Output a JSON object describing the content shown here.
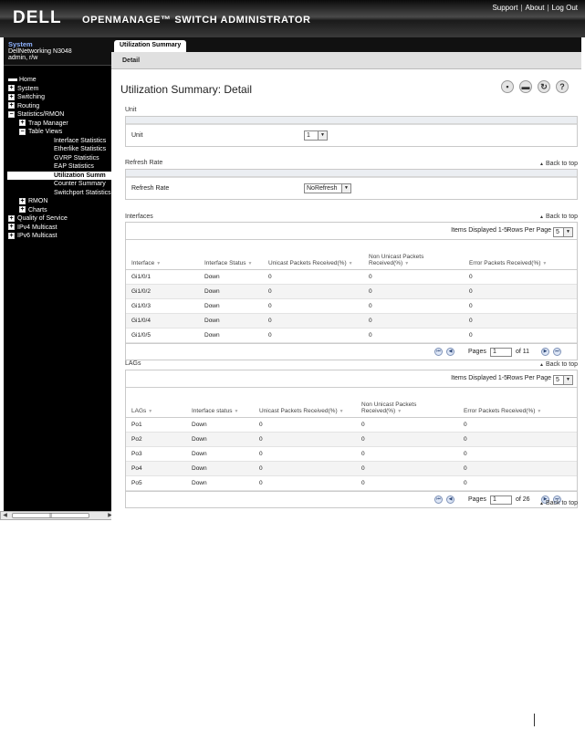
{
  "header": {
    "logo": "DELL",
    "product": "OPENMANAGE™ SWITCH ADMINISTRATOR",
    "links": [
      "Support",
      "About",
      "Log Out"
    ]
  },
  "sidebar": {
    "system_title": "System",
    "system_model": "DellNetworking N3048",
    "user": "admin, r/w",
    "items": [
      {
        "label": "Home"
      },
      {
        "label": "System"
      },
      {
        "label": "Switching"
      },
      {
        "label": "Routing"
      },
      {
        "label": "Statistics/RMON"
      },
      {
        "label": "Trap Manager"
      },
      {
        "label": "Table Views"
      },
      {
        "label": "Interface Statistics"
      },
      {
        "label": "Etherlike Statistics"
      },
      {
        "label": "GVRP Statistics"
      },
      {
        "label": "EAP Statistics"
      },
      {
        "label": "Utilization Summ"
      },
      {
        "label": "Counter Summary"
      },
      {
        "label": "Switchport Statistics"
      },
      {
        "label": "RMON"
      },
      {
        "label": "Charts"
      },
      {
        "label": "Quality of Service"
      },
      {
        "label": "IPv4 Multicast"
      },
      {
        "label": "IPv6 Multicast"
      }
    ]
  },
  "tabs": {
    "active": "Utilization Summary",
    "sub": "Detail"
  },
  "page": {
    "title": "Utilization Summary: Detail",
    "back_to_top": "Back to top"
  },
  "unit": {
    "section": "Unit",
    "label": "Unit",
    "value": "1"
  },
  "refresh": {
    "section": "Refresh Rate",
    "label": "Refresh Rate",
    "value": "NoRefresh"
  },
  "interfaces": {
    "section": "Interfaces",
    "items_displayed": "Items Displayed 1-5",
    "rows_per_page_label": "Rows Per Page",
    "rows_per_page": "5",
    "columns": [
      "Interface",
      "Interface Status",
      "Unicast Packets Received(%)",
      "Non Unicast Packets Received(%)",
      "Error Packets Received(%)"
    ],
    "rows": [
      [
        "Gi1/0/1",
        "Down",
        "0",
        "0",
        "0"
      ],
      [
        "Gi1/0/2",
        "Down",
        "0",
        "0",
        "0"
      ],
      [
        "Gi1/0/3",
        "Down",
        "0",
        "0",
        "0"
      ],
      [
        "Gi1/0/4",
        "Down",
        "0",
        "0",
        "0"
      ],
      [
        "Gi1/0/5",
        "Down",
        "0",
        "0",
        "0"
      ]
    ],
    "pages_label": "Pages",
    "page": "1",
    "of": "of 11"
  },
  "lags": {
    "section": "LAGs",
    "items_displayed": "Items Displayed 1-5",
    "rows_per_page_label": "Rows Per Page",
    "rows_per_page": "5",
    "columns": [
      "LAGs",
      "Interface status",
      "Unicast Packets Received(%)",
      "Non Unicast Packets Received(%)",
      "Error Packets Received(%)"
    ],
    "rows": [
      [
        "Po1",
        "Down",
        "0",
        "0",
        "0"
      ],
      [
        "Po2",
        "Down",
        "0",
        "0",
        "0"
      ],
      [
        "Po3",
        "Down",
        "0",
        "0",
        "0"
      ],
      [
        "Po4",
        "Down",
        "0",
        "0",
        "0"
      ],
      [
        "Po5",
        "Down",
        "0",
        "0",
        "0"
      ]
    ],
    "pages_label": "Pages",
    "page": "1",
    "of": "of 26"
  }
}
